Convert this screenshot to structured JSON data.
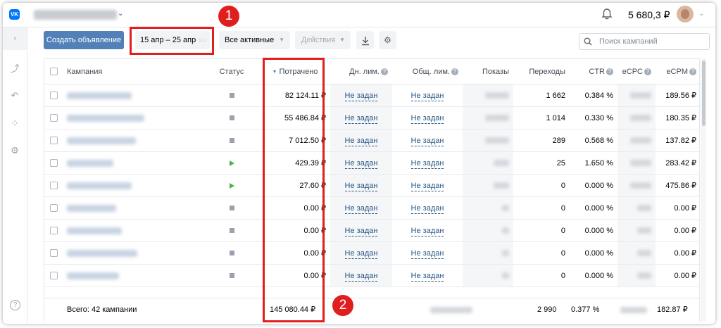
{
  "header": {
    "logo": "VK",
    "account_chevron": "⌄",
    "balance": "5 680,3 ₽",
    "avatar_chevron": "⌄",
    "bell_icon": "bell-icon"
  },
  "sidebar": {
    "expand": "›",
    "items": [
      {
        "icon": "stats-icon",
        "glyph": "⤴"
      },
      {
        "icon": "undo-icon",
        "glyph": "↶"
      },
      {
        "icon": "apps-icon",
        "glyph": "⁘"
      },
      {
        "icon": "gear-icon",
        "glyph": "⚙"
      },
      {
        "icon": "help-icon",
        "glyph": "?"
      }
    ]
  },
  "toolbar": {
    "create_label": "Создать объявление",
    "date_range": "15 апр – 25 апр",
    "status_filter": "Все активные",
    "actions_label": "Действия",
    "search_placeholder": "Поиск кампаний"
  },
  "annotations": {
    "badge1": "1",
    "badge2": "2"
  },
  "table": {
    "headers": {
      "campaign": "Кампания",
      "status": "Статус",
      "spent": "Потрачено",
      "day_limit": "Дн. лим.",
      "total_limit": "Общ. лим.",
      "impressions": "Показы",
      "clicks": "Переходы",
      "ctr": "CTR",
      "ecpc": "eCPC",
      "ecpm": "eCPM"
    },
    "rows": [
      {
        "status": "stopped",
        "spent": "82 124.11 ₽",
        "day_limit": "Не задан",
        "total_limit": "Не задан",
        "clicks": "1 662",
        "ctr": "0.384 %",
        "ecpm": "189.56 ₽"
      },
      {
        "status": "stopped",
        "spent": "55 486.84 ₽",
        "day_limit": "Не задан",
        "total_limit": "Не задан",
        "clicks": "1 014",
        "ctr": "0.330 %",
        "ecpm": "180.35 ₽"
      },
      {
        "status": "stopped",
        "spent": "7 012.50 ₽",
        "day_limit": "Не задан",
        "total_limit": "Не задан",
        "clicks": "289",
        "ctr": "0.568 %",
        "ecpm": "137.82 ₽"
      },
      {
        "status": "active",
        "spent": "429.39 ₽",
        "day_limit": "Не задан",
        "total_limit": "Не задан",
        "clicks": "25",
        "ctr": "1.650 %",
        "ecpm": "283.42 ₽"
      },
      {
        "status": "active",
        "spent": "27.60 ₽",
        "day_limit": "Не задан",
        "total_limit": "Не задан",
        "clicks": "0",
        "ctr": "0.000 %",
        "ecpm": "475.86 ₽"
      },
      {
        "status": "stopped",
        "spent": "0.00 ₽",
        "day_limit": "Не задан",
        "total_limit": "Не задан",
        "clicks": "0",
        "ctr": "0.000 %",
        "ecpm": "0.00 ₽"
      },
      {
        "status": "stopped",
        "spent": "0.00 ₽",
        "day_limit": "Не задан",
        "total_limit": "Не задан",
        "clicks": "0",
        "ctr": "0.000 %",
        "ecpm": "0.00 ₽"
      },
      {
        "status": "stopped",
        "spent": "0.00 ₽",
        "day_limit": "Не задан",
        "total_limit": "Не задан",
        "clicks": "0",
        "ctr": "0.000 %",
        "ecpm": "0.00 ₽"
      },
      {
        "status": "stopped",
        "spent": "0.00 ₽",
        "day_limit": "Не задан",
        "total_limit": "Не задан",
        "clicks": "0",
        "ctr": "0.000 %",
        "ecpm": "0.00 ₽"
      }
    ],
    "footer": {
      "total_label": "Всего: 42 кампании",
      "spent": "145 080.44 ₽",
      "clicks": "2 990",
      "ctr": "0.377 %",
      "ecpm": "182.87 ₽"
    }
  },
  "colors": {
    "accent": "#5181b8",
    "highlight": "#e11e1e",
    "link": "#2a5885",
    "active_status": "#4bb34b"
  }
}
